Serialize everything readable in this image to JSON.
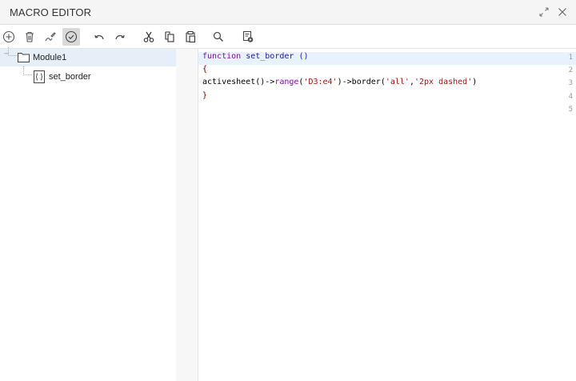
{
  "window": {
    "title": "MACRO EDITOR",
    "controls": [
      {
        "name": "restore-icon",
        "symbol": "⤡"
      },
      {
        "name": "close-icon",
        "symbol": "✕"
      }
    ]
  },
  "toolbar": {
    "buttons": [
      {
        "name": "add-button",
        "icon": "circle-plus-icon"
      },
      {
        "name": "delete-button",
        "icon": "trash-icon"
      },
      {
        "name": "rename-button",
        "icon": "rename-pen-icon"
      },
      {
        "name": "compile-button",
        "icon": "check-circle-icon",
        "active": true
      },
      {
        "name": "undo-button",
        "icon": "undo-icon"
      },
      {
        "name": "redo-button",
        "icon": "redo-icon"
      },
      {
        "name": "cut-button",
        "icon": "scissors-icon"
      },
      {
        "name": "copy-button",
        "icon": "copy-icon"
      },
      {
        "name": "paste-button",
        "icon": "paste-icon"
      },
      {
        "name": "find-button",
        "icon": "search-icon"
      },
      {
        "name": "run-button",
        "icon": "run-macro-icon"
      }
    ]
  },
  "tree": {
    "module": {
      "label": "Module1",
      "expander": "−"
    },
    "macro": {
      "label": "set_border"
    }
  },
  "editor": {
    "line_numbers": [
      "1",
      "2",
      "3",
      "4",
      "5"
    ],
    "lines": [
      [
        {
          "t": "function",
          "c": "kw"
        },
        {
          "t": " ",
          "c": ""
        },
        {
          "t": "set_border",
          "c": "fn"
        },
        {
          "t": " ()",
          "c": "fn"
        }
      ],
      [
        {
          "t": "{",
          "c": "brace"
        }
      ],
      [
        {
          "t": "activesheet()->",
          "c": ""
        },
        {
          "t": "range",
          "c": "kw"
        },
        {
          "t": "(",
          "c": ""
        },
        {
          "t": "'D3:e4'",
          "c": "str"
        },
        {
          "t": ")->border(",
          "c": ""
        },
        {
          "t": "'all'",
          "c": "str"
        },
        {
          "t": ",",
          "c": ""
        },
        {
          "t": "'2px dashed'",
          "c": "str"
        },
        {
          "t": ")",
          "c": ""
        }
      ],
      [
        {
          "t": "}",
          "c": "brace"
        }
      ],
      []
    ]
  }
}
